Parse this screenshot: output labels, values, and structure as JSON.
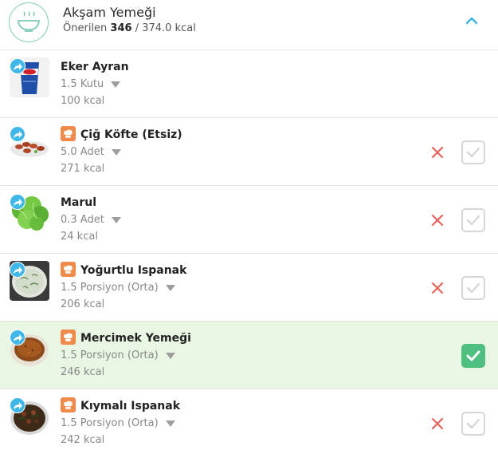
{
  "meal": {
    "title": "Akşam Yemeği",
    "recommended_label": "Önerilen",
    "recommended_value": "346",
    "target": " / 374.0 kcal",
    "icon": "bowl-icon",
    "collapse_icon": "chevron-up-icon"
  },
  "colors": {
    "accent_blue": "#3fb7e8",
    "check_green": "#4fbf7f",
    "checked_row_bg": "#eaf6e4",
    "remove_red": "#e8625c",
    "recipe_orange": "#f08a4b"
  },
  "foods": [
    {
      "name": "Eker Ayran",
      "portion": "1.5 Kutu",
      "kcal": "100 kcal",
      "recipe": false,
      "checked": true,
      "thumb": "ayran-cup"
    },
    {
      "name": "Çiğ Köfte (Etsiz)",
      "portion": "5.0 Adet",
      "kcal": "271 kcal",
      "recipe": true,
      "checked": false,
      "thumb": "cig-kofte-plate"
    },
    {
      "name": "Marul",
      "portion": "0.3 Adet",
      "kcal": "24 kcal",
      "recipe": false,
      "checked": false,
      "thumb": "lettuce"
    },
    {
      "name": "Yoğurtlu Ispanak",
      "portion": "1.5 Porsiyon (Orta)",
      "kcal": "206 kcal",
      "recipe": true,
      "checked": false,
      "thumb": "spinach-yogurt-bowl"
    },
    {
      "name": "Mercimek Yemeği",
      "portion": "1.5 Porsiyon (Orta)",
      "kcal": "246 kcal",
      "recipe": true,
      "checked": true,
      "thumb": "lentil-bowl"
    },
    {
      "name": "Kıymalı Ispanak",
      "portion": "1.5 Porsiyon (Orta)",
      "kcal": "242 kcal",
      "recipe": true,
      "checked": false,
      "thumb": "spinach-mince-plate"
    }
  ]
}
